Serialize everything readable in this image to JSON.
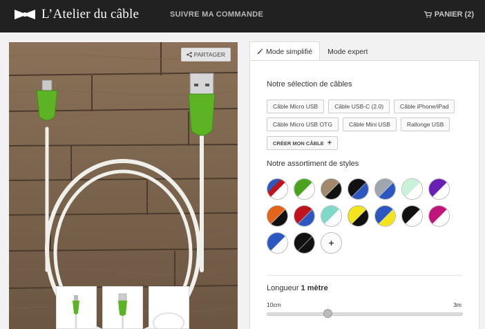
{
  "header": {
    "brand": "L’Atelier du câble",
    "nav_track": "SUIVRE MA COMMANDE",
    "cart_label": "PANIER (2)"
  },
  "gallery": {
    "share_label": "PARTAGER",
    "thumbnail_count": 3
  },
  "tabs": [
    {
      "label": "Mode simplifié",
      "active": true
    },
    {
      "label": "Mode expert",
      "active": false
    }
  ],
  "cables": {
    "title": "Notre sélection de câbles",
    "buttons": [
      "Câble Micro USB",
      "Câble USB-C (2.0)",
      "Câble iPhone/iPad",
      "Câble Micro USB OTG",
      "Câble Mini USB",
      "Rallonge USB"
    ],
    "create_label": "CRÉER MON CÂBLE",
    "create_icon": "plus-icon"
  },
  "styles": {
    "title": "Notre assortiment de styles",
    "swatches": [
      {
        "name": "red-blue",
        "colors": [
          "#c0141d",
          "#2d57c0",
          "#ffffff"
        ]
      },
      {
        "name": "green-white",
        "colors": [
          "#4aa31e",
          "#ffffff"
        ]
      },
      {
        "name": "tan-black",
        "colors": [
          "#a08a6b",
          "#111111"
        ]
      },
      {
        "name": "black-blue",
        "colors": [
          "#111111",
          "#2d57c0"
        ]
      },
      {
        "name": "grey-blue",
        "colors": [
          "#9fa6ad",
          "#2d57c0"
        ]
      },
      {
        "name": "mint-white",
        "colors": [
          "#c8f2d9",
          "#ffffff"
        ]
      },
      {
        "name": "purple-white",
        "colors": [
          "#6a1fb4",
          "#ffffff"
        ]
      },
      {
        "name": "orange-black",
        "colors": [
          "#e4641b",
          "#111111"
        ]
      },
      {
        "name": "red-blue-2",
        "colors": [
          "#c0141d",
          "#2d57c0"
        ]
      },
      {
        "name": "teal-white",
        "colors": [
          "#7fd9c9",
          "#ffffff"
        ]
      },
      {
        "name": "yellow-black",
        "colors": [
          "#f2e51e",
          "#111111"
        ]
      },
      {
        "name": "blue-yellow",
        "colors": [
          "#2d57c0",
          "#f2e51e"
        ]
      },
      {
        "name": "black-white",
        "colors": [
          "#111111",
          "#ffffff"
        ]
      },
      {
        "name": "magenta-white",
        "colors": [
          "#c0137c",
          "#ffffff"
        ]
      },
      {
        "name": "blue-white",
        "colors": [
          "#2d57c0",
          "#ffffff"
        ]
      },
      {
        "name": "black-black",
        "colors": [
          "#111111",
          "#111111"
        ]
      }
    ],
    "add_label": "+"
  },
  "length": {
    "label": "Longueur",
    "value": "1 mètre",
    "min_label": "10cm",
    "max_label": "3m",
    "position_fraction": 0.31
  },
  "colors": {
    "topbar": "#212121",
    "cable_green": "#5cb324",
    "cable_white": "#f0f0ea"
  }
}
